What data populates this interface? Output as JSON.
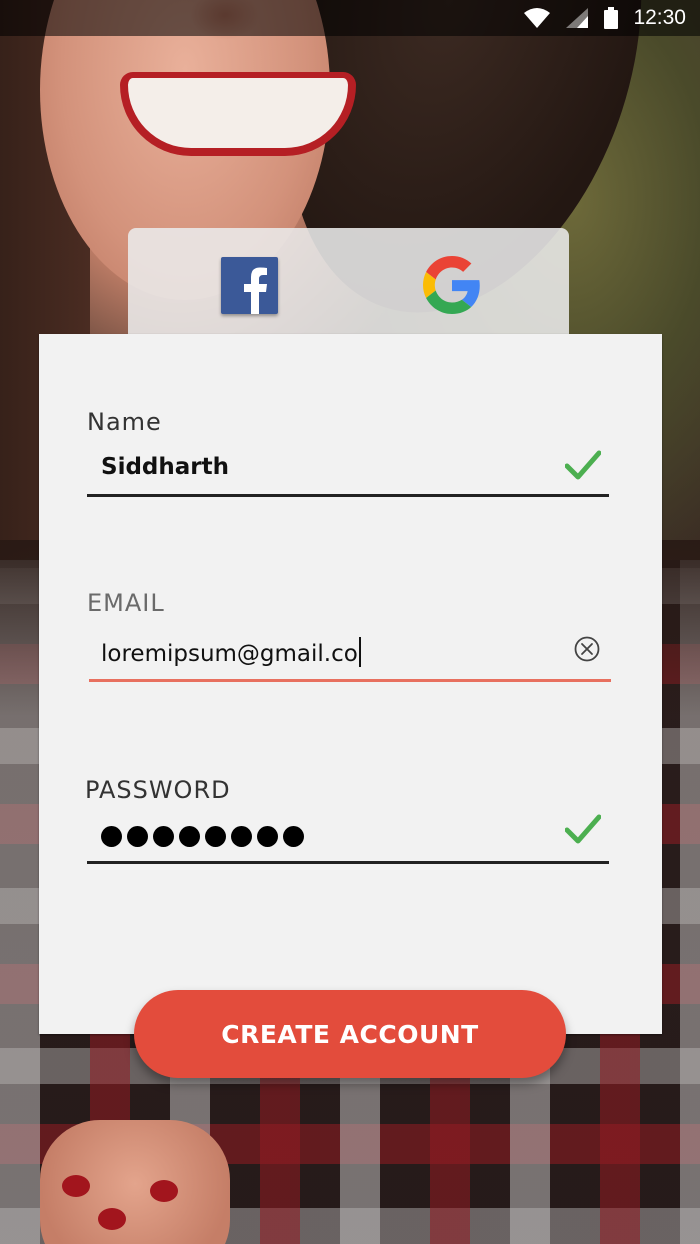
{
  "status_bar": {
    "time": "12:30",
    "icons": [
      "wifi-icon",
      "cellular-signal-icon",
      "battery-icon"
    ]
  },
  "social_login": {
    "providers": [
      {
        "name": "Facebook",
        "icon": "facebook-icon",
        "color": "#3b5998"
      },
      {
        "name": "Google",
        "icon": "google-icon"
      }
    ]
  },
  "form": {
    "name": {
      "label": "Name",
      "value": "Siddharth",
      "status": "valid",
      "status_icon": "checkmark-icon"
    },
    "email": {
      "label": "EMAIL",
      "value": "loremipsum@gmail.co",
      "status": "error",
      "status_icon": "clear-circle-icon"
    },
    "password": {
      "label": "PASSWORD",
      "masked_length": 8,
      "status": "valid",
      "status_icon": "checkmark-icon"
    }
  },
  "actions": {
    "create_account_label": "CREATE ACCOUNT"
  },
  "colors": {
    "accent": "#e34c3c",
    "error_underline": "#e8705f",
    "valid_check": "#4caf50",
    "facebook": "#3b5998"
  }
}
